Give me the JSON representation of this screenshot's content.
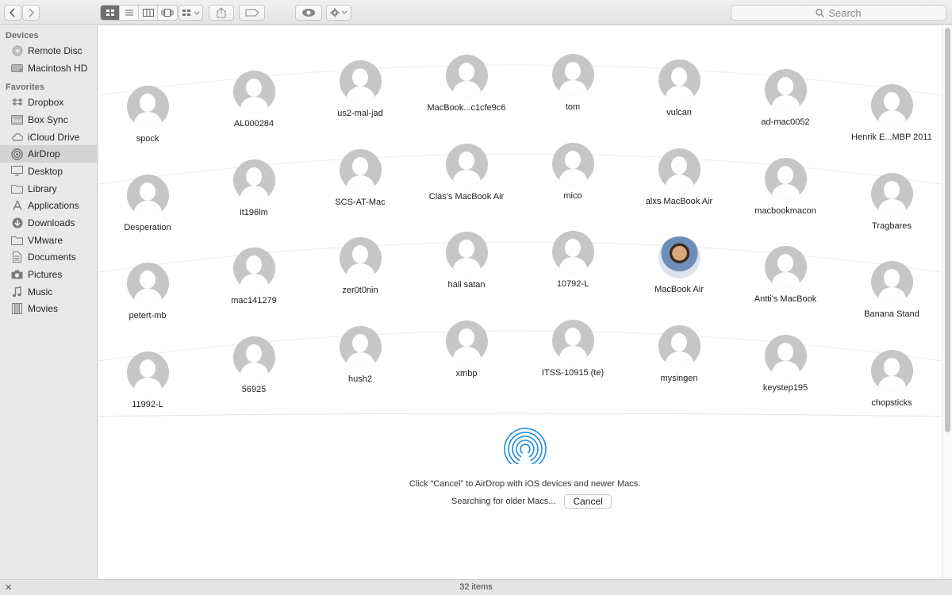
{
  "toolbar": {
    "back_icon": "chevron-left-icon",
    "forward_icon": "chevron-right-icon",
    "view_modes": [
      "icon-view-icon",
      "list-view-icon",
      "column-view-icon",
      "cover-flow-icon"
    ],
    "active_view": "icon-view-icon",
    "arrange_icon": "arrange-icon",
    "share_icon": "share-icon",
    "tag_icon": "tag-icon",
    "quicklook_icon": "eye-icon",
    "action_icon": "gear-icon"
  },
  "search": {
    "placeholder": "Search"
  },
  "sidebar": {
    "sections": [
      {
        "title": "Devices",
        "items": [
          {
            "label": "Remote Disc",
            "icon": "disc-icon"
          },
          {
            "label": "Macintosh HD",
            "icon": "drive-icon"
          }
        ]
      },
      {
        "title": "Favorites",
        "items": [
          {
            "label": "Dropbox",
            "icon": "dropbox-icon"
          },
          {
            "label": "Box Sync",
            "icon": "box-icon"
          },
          {
            "label": "iCloud Drive",
            "icon": "cloud-icon"
          },
          {
            "label": "AirDrop",
            "icon": "airdrop-icon",
            "selected": true
          },
          {
            "label": "Desktop",
            "icon": "desktop-icon"
          },
          {
            "label": "Library",
            "icon": "folder-icon"
          },
          {
            "label": "Applications",
            "icon": "applications-icon"
          },
          {
            "label": "Downloads",
            "icon": "download-icon"
          },
          {
            "label": "VMware",
            "icon": "folder-icon"
          },
          {
            "label": "Documents",
            "icon": "document-icon"
          },
          {
            "label": "Pictures",
            "icon": "camera-icon"
          },
          {
            "label": "Music",
            "icon": "music-icon"
          },
          {
            "label": "Movies",
            "icon": "film-icon"
          }
        ]
      }
    ]
  },
  "devices": [
    [
      "spock",
      "AL000284",
      "us2-mal-jad",
      "MacBook...c1cfe9c6",
      "tom",
      "vulcan",
      "ad-mac0052",
      "Henrik E...MBP 2011"
    ],
    [
      "Desperation",
      "it196lm",
      "SCS-AT-Mac",
      "Clas's MacBook Air",
      "mico",
      "alxs MacBook Air",
      "macbookmacon",
      "Tragbares"
    ],
    [
      "petert-mb",
      "mac141279",
      "zer0t0nin",
      "hail satan",
      "10792-L",
      "MacBook Air",
      "Antti's MacBook",
      "Banana Stand"
    ],
    [
      "11992-L",
      "56925",
      "hush2",
      "xmbp",
      "ITSS-10915 (te)",
      "mysingen",
      "keystep195",
      "chopsticks"
    ]
  ],
  "photo_device": "MacBook Air",
  "airdrop": {
    "logo_icon": "airdrop-logo-icon",
    "hint": "Click “Cancel” to AirDrop with iOS devices and newer Macs.",
    "searching": "Searching for older Macs...",
    "cancel_label": "Cancel"
  },
  "status": {
    "count_text": "32 items",
    "icon": "resize-icon"
  },
  "colors": {
    "accent": "#1a8ce6",
    "avatar_gray": "#c6c6c6",
    "sidebar_selected": "#d3d3d3"
  }
}
